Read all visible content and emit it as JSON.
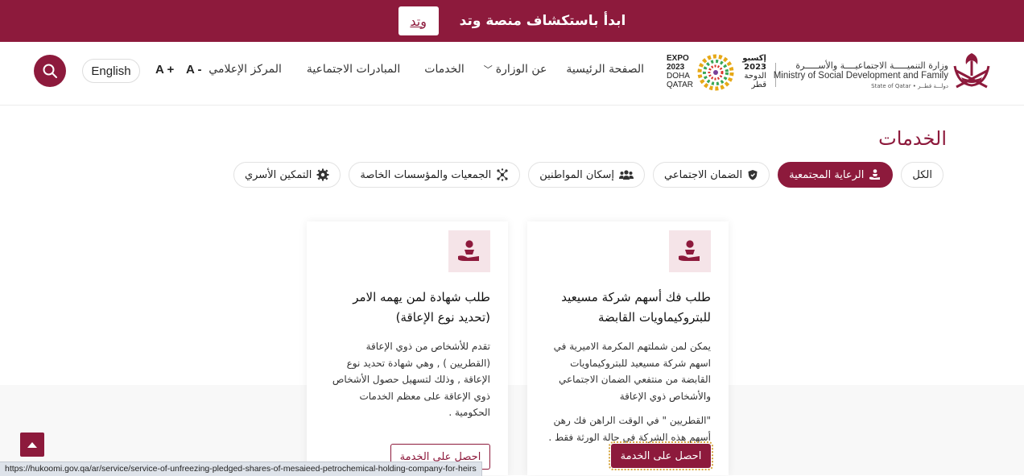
{
  "banner": {
    "text": "ابدأ باستكشاف منصة وتد",
    "button_label": "وتد"
  },
  "header": {
    "nav": [
      {
        "label": "الصفحة الرئيسية"
      },
      {
        "label": "عن الوزارة",
        "has_dropdown": true
      },
      {
        "label": "الخدمات"
      },
      {
        "label": "المبادرات الاجتماعية"
      },
      {
        "label": "المركز الإعلامي"
      }
    ],
    "font_decrease": "A -",
    "font_increase": "A +",
    "language": "English",
    "ministry_name_ar": "وزارة التنميـــــة الاجتماعيــــة والأســـــرة",
    "ministry_name_en": "Ministry of Social Development and Family",
    "state_label": "State of Qatar • دولـــة قطــر",
    "expo": {
      "en1": "EXPO",
      "en2": "2023",
      "en3": "DOHA",
      "en4": "QATAR",
      "ar1": "إكسبو",
      "ar2": "2023",
      "ar3": "الدوحة",
      "ar4": "قطر"
    }
  },
  "page_title": "الخدمات",
  "filters": [
    {
      "label": "الكل",
      "icon": "none",
      "active": false
    },
    {
      "label": "الرعاية المجتمعية",
      "icon": "care-hand-icon",
      "active": true
    },
    {
      "label": "الضمان الاجتماعي",
      "icon": "shield-icon",
      "active": false
    },
    {
      "label": "إسكان المواطنين",
      "icon": "people-icon",
      "active": false
    },
    {
      "label": "الجمعيات والمؤسسات الخاصة",
      "icon": "network-icon",
      "active": false
    },
    {
      "label": "التمكين الأسري",
      "icon": "gear-icon",
      "active": false
    }
  ],
  "cards": [
    {
      "title_line1": "طلب فك أسهم شركة مسيعيد",
      "title_line2": "للبتروكيماويات القابضة",
      "desc_line1": "يمكن لمن شملتهم المكرمة الاميرية في",
      "desc_line2": "اسهم شركة مسيعيد للبتروكيماويات",
      "desc_line3": "القابضة من منتفعي الضمان الاجتماعي",
      "desc_line4": "والأشخاص ذوي الإعاقة",
      "desc_line5": "\"القطريين \" في الوقت الراهن فك رهن",
      "desc_line6": "أسهم هذه الشركة في حالة الورثة فقط .",
      "button": "احصل على الخدمة"
    },
    {
      "title_line1": "طلب شهادة لمن يهمه الامر",
      "title_line2": "(تحديد نوع الإعاقة)",
      "desc_line1": "تقدم للأشخاص من ذوي الإعاقة",
      "desc_line2": "(القطريين ) , وهي شهادة تحديد نوع",
      "desc_line3": "الإعاقة , وذلك لتسهيل حصول الأشخاص",
      "desc_line4": "ذوي الإعاقة على معظم الخدمات",
      "desc_line5": "الحكومية .",
      "button": "احصل على الخدمة"
    }
  ],
  "status_url": "https://hukoomi.gov.qa/ar/service/service-of-unfreezing-pledged-shares-of-mesaieed-petrochemical-holding-company-for-heirs",
  "colors": {
    "brand": "#8d1a3c",
    "chip_border": "#e2e2e2",
    "icon_bg": "#f5e4e8"
  }
}
